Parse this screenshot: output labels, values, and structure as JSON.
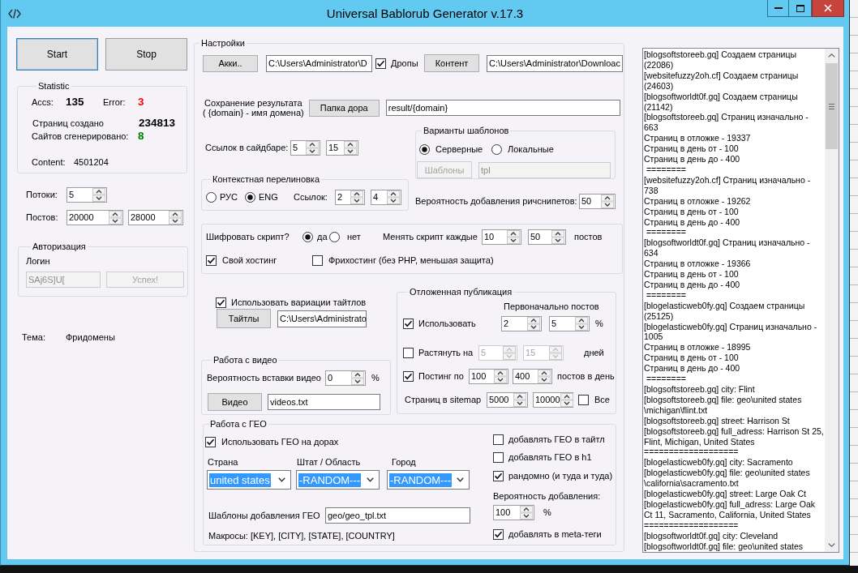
{
  "window": {
    "title": "Universal Bablorub Generator v.17.3"
  },
  "actions": [
    {
      "label": "Start",
      "focused": true
    },
    {
      "label": "Stop",
      "focused": false
    }
  ],
  "statistic": {
    "title": "Statistic",
    "rows": [
      [
        {
          "label": "Accs:",
          "value": "135",
          "bold": true,
          "color": "#000000"
        },
        {
          "label": "Error:",
          "value": "3",
          "bold": true,
          "color": "#ff0000"
        }
      ],
      [
        {
          "label": "Страниц создано",
          "value": "234813",
          "bold": true,
          "color": "#000000"
        }
      ],
      [
        {
          "label": "Сайтов сгенерировано:",
          "value": "8",
          "bold": true,
          "color": "#008000"
        }
      ],
      [
        {
          "label": "Content:",
          "value": "4501204",
          "bold": false,
          "color": "#000000"
        }
      ]
    ]
  },
  "run_fields": [
    {
      "label": "Потоки:",
      "spins": [
        "5"
      ]
    },
    {
      "label": "Постов:",
      "spins": [
        "20000",
        "28000"
      ]
    }
  ],
  "authorization": {
    "title": "Авторизация",
    "login_label": "Логин",
    "login": "SAj6S]U[",
    "button": "Успех!",
    "disabled": true
  },
  "theme": {
    "label": "Тема:",
    "value": "Фридомены"
  },
  "settings": {
    "title": "Настройки",
    "accounts": {
      "button": "Акки..",
      "path": "C:\\Users\\Administrator\\D"
    },
    "drops": {
      "label": "Дропы",
      "checked": true
    },
    "content": {
      "button": "Контент",
      "path": "C:\\Users\\Administrator\\Downloac"
    },
    "result": {
      "label": "Сохранение результата\n( {domain} - имя домена)",
      "button": "Папка дора",
      "path": "result/{domain}"
    },
    "templates": {
      "title": "Варианты шаблонов",
      "options": [
        {
          "label": "Серверные",
          "selected": true
        },
        {
          "label": "Локальные",
          "selected": false
        }
      ],
      "button": "Шаблоны",
      "path": "tpl",
      "disabled": true
    },
    "sidebar_links": {
      "label": "Ссылок в сайдбаре:",
      "spins": [
        "5",
        "15"
      ]
    },
    "context_linking": {
      "title": "Контекстная перелиновка",
      "options": [
        {
          "label": "РУС",
          "selected": false
        },
        {
          "label": "ENG",
          "selected": true
        }
      ],
      "links_label": "Ссылок:",
      "spins": [
        "2",
        "4"
      ]
    },
    "richsnippets": {
      "label": "Вероятность добавления ричснипетов:",
      "value": "50"
    },
    "script": {
      "label": "Шифровать скрипт?",
      "options": [
        {
          "label": "да",
          "selected": true
        },
        {
          "label": "нет",
          "selected": false
        }
      ],
      "change_label": "Менять скрипт каждые",
      "spins": [
        "10",
        "50"
      ],
      "unit": "постов",
      "hosting": [
        {
          "label": "Свой хостинг",
          "checked": true
        },
        {
          "label": "Фрихостинг (без PHP, меньшая защита)",
          "checked": false
        }
      ]
    },
    "titles": {
      "label": "Использовать вариации тайтлов",
      "checked": true,
      "button": "Тайтлы",
      "path": "C:\\Users\\Administrato"
    },
    "video": {
      "title": "Работа с видео",
      "label": "Вероятность вставки видео",
      "value": "0",
      "unit": "%",
      "button": "Видео",
      "path": "videos.txt"
    },
    "delayed": {
      "title": "Отложенная публикация",
      "header": "Первоначально постов",
      "rows": [
        {
          "label": "Использовать",
          "checked": true,
          "spins": [
            "2",
            "5"
          ],
          "unit": "%"
        },
        {
          "label": "Растянуть на",
          "checked": false,
          "spins": [
            "5",
            "15"
          ],
          "unit": "дней"
        },
        {
          "label": "Постинг по",
          "checked": true,
          "spins": [
            "100",
            "400"
          ],
          "unit": "постов в день"
        }
      ],
      "sitemap": {
        "label": "Страниц в sitemap",
        "spins": [
          "5000",
          "10000"
        ],
        "check": {
          "label": "Все",
          "checked": false
        }
      }
    },
    "geo": {
      "title": "Работа с ГЕО",
      "use": {
        "label": "Использовать ГЕО на дорах",
        "checked": true
      },
      "selects": [
        {
          "label": "Страна",
          "value": "united states",
          "highlighted": true
        },
        {
          "label": "Штат / Область",
          "value": "-RANDOM---",
          "highlighted": true
        },
        {
          "label": "Город",
          "value": "-RANDOM---",
          "highlighted": true
        }
      ],
      "template_label": "Шаблоны добавления ГЕО",
      "template": "geo/geo_tpl.txt",
      "macros": "Макросы: [KEY], [CITY], [STATE], [COUNTRY]",
      "options": [
        {
          "label": "добавлять ГЕО в тайтл",
          "checked": false
        },
        {
          "label": "добавлять ГЕО в h1",
          "checked": false
        },
        {
          "label": "рандомно (и туда и туда)",
          "checked": true
        }
      ],
      "probability_label": "Вероятность добавления:",
      "probability": "100",
      "unit": "%",
      "meta": {
        "label": "добавлять в meta-теги",
        "checked": true
      }
    }
  },
  "log": {
    "lines": [
      "[blogsoftstoreeb.gq] Создаем страницы",
      "(22086)",
      "[websitefuzzy2oh.cf] Создаем страницы",
      "(24603)",
      "[blogsoftworldt0f.gq] Создаем страницы",
      "(21142)",
      "[blogsoftstoreeb.gq] Страниц изначально -",
      "663",
      "Страниц в отложке - 19337",
      "Страниц в день от - 100",
      "Страниц в день до - 400",
      " ========",
      "[websitefuzzy2oh.cf] Страниц изначально -",
      "738",
      "Страниц в отложке - 19262",
      "Страниц в день от - 100",
      "Страниц в день до - 400",
      " ========",
      "[blogsoftworldt0f.gq] Страниц изначально -",
      "634",
      "Страниц в отложке - 19366",
      "Страниц в день от - 100",
      "Страниц в день до - 400",
      " ========",
      "[blogelasticweb0fy.gq] Создаем страницы",
      "(25125)",
      "[blogelasticweb0fy.gq] Страниц изначально -",
      "1005",
      "Страниц в отложке - 18995",
      "Страниц в день от - 100",
      "Страниц в день до - 400",
      " ========",
      "[blogsoftstoreeb.gq] city: Flint",
      "[blogsoftstoreeb.gq] file: geo\\united states",
      "\\michigan\\flint.txt",
      "[blogsoftstoreeb.gq] street: Harrison St",
      "[blogsoftstoreeb.gq] full_adress: Harrison St 25,",
      "Flint, Michigan, United States",
      "===================",
      "[blogelasticweb0fy.gq] city: Sacramento",
      "[blogelasticweb0fy.gq] file: geo\\united states",
      "\\california\\sacramento.txt",
      "[blogelasticweb0fy.gq] street: Large Oak Ct",
      "[blogelasticweb0fy.gq] full_adress: Large Oak",
      "Ct 11, Sacramento, California, United States",
      "===================",
      "[blogsoftworldt0f.gq] city: Cleveland",
      "[blogsoftworldt0f.gq] file: geo\\united states"
    ]
  }
}
